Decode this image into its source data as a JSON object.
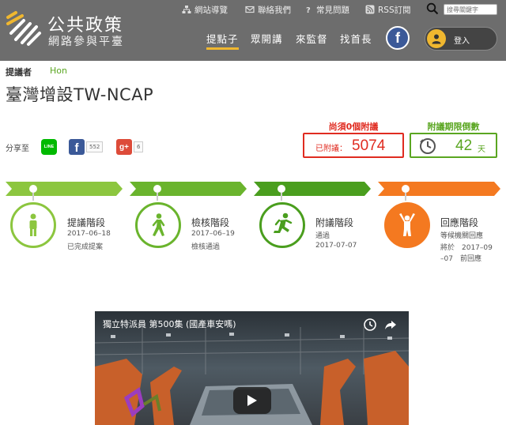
{
  "header": {
    "site_title": "公共政策",
    "site_subtitle": "網路參與平臺",
    "utility_links": [
      {
        "label": "網站導覽",
        "icon": "sitemap-icon"
      },
      {
        "label": "聯絡我們",
        "icon": "mail-icon"
      },
      {
        "label": "常見問題",
        "icon": "question-icon"
      },
      {
        "label": "RSS訂閱",
        "icon": "rss-icon"
      }
    ],
    "search": {
      "placeholder": "搜尋關鍵字"
    },
    "nav": [
      {
        "label": "提點子",
        "active": true
      },
      {
        "label": "眾開講",
        "active": false
      },
      {
        "label": "來監督",
        "active": false
      },
      {
        "label": "找首長",
        "active": false
      }
    ],
    "facebook_letter": "f",
    "login_label": "登入",
    "colors": {
      "bg": "#6d6d6d",
      "accent": "#f0b72f"
    }
  },
  "proposal": {
    "proposer_label": "提議者",
    "proposer_name": "Hon",
    "title": "臺灣增設TW-NCAP"
  },
  "share": {
    "label": "分享至",
    "line_label": "LINE",
    "facebook_letter": "f",
    "facebook_count": "552",
    "gplus_label": "g+",
    "gplus_count": "6"
  },
  "counters": {
    "need_label": "尚須0個附議",
    "seconded_label": "已附議：",
    "seconded_count": "5074",
    "deadline_label": "附議期限倒數",
    "days_remaining": "42",
    "days_unit": "天"
  },
  "stages": [
    {
      "name": "提議階段",
      "lines": [
        "2017–06–18",
        "已完成提案"
      ],
      "color": "#8cc63f",
      "icon": "standing-person-icon"
    },
    {
      "name": "檢核階段",
      "lines": [
        "2017–06–19",
        "檢核通過"
      ],
      "color": "#6ab42d",
      "icon": "walking-person-icon"
    },
    {
      "name": "附議階段",
      "lines": [
        "通過",
        "2017-07-07"
      ],
      "color": "#4a9e1e",
      "icon": "running-person-icon"
    },
    {
      "name": "回應階段",
      "lines": [
        "等候機關回應",
        "將於　2017–09",
        "–07　前回應"
      ],
      "color": "#f47920",
      "icon": "cheering-person-icon"
    }
  ],
  "video": {
    "title": "獨立特派員 第500集 (國產車安嗎)"
  }
}
